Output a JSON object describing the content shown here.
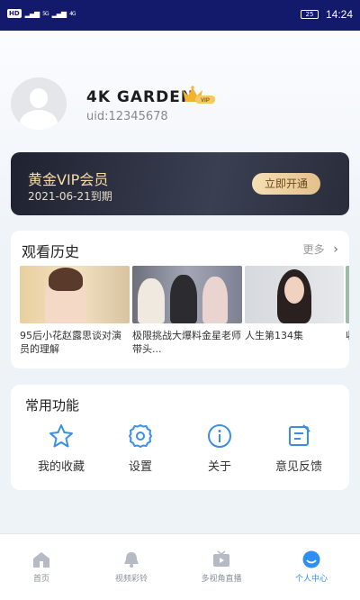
{
  "status_bar": {
    "hd": "HD",
    "signal_1": "5G",
    "signal_2": "4G",
    "battery": "25",
    "time": "14:24"
  },
  "profile": {
    "name": "4K GARDEN",
    "vip_badge": "VIP",
    "uid": "uid:12345678"
  },
  "vip_card": {
    "title": "黄金VIP会员",
    "expiry": "2021-06-21到期",
    "button": "立即开通"
  },
  "history": {
    "title": "观看历史",
    "more": "更多",
    "items": [
      {
        "caption": "95后小花赵露思谈对演员的理解"
      },
      {
        "caption": "极限挑战大爆料金星老师带头..."
      },
      {
        "caption": "人生第134集"
      },
      {
        "caption": "收"
      }
    ]
  },
  "functions": {
    "title": "常用功能",
    "items": [
      {
        "label": "我的收藏",
        "icon": "star-icon"
      },
      {
        "label": "设置",
        "icon": "gear-icon"
      },
      {
        "label": "关于",
        "icon": "info-icon"
      },
      {
        "label": "意见反馈",
        "icon": "feedback-icon"
      }
    ]
  },
  "tab_bar": {
    "items": [
      {
        "label": "首页",
        "icon": "home-icon"
      },
      {
        "label": "视频彩铃",
        "icon": "bell-icon"
      },
      {
        "label": "多视角直播",
        "icon": "tv-icon"
      },
      {
        "label": "个人中心",
        "icon": "face-icon",
        "active": true
      }
    ]
  },
  "colors": {
    "status_bar": "#13196b",
    "accent": "#2f8ff0",
    "icon_blue": "#3a8ee6",
    "vip_gold": "#f6dca5"
  }
}
